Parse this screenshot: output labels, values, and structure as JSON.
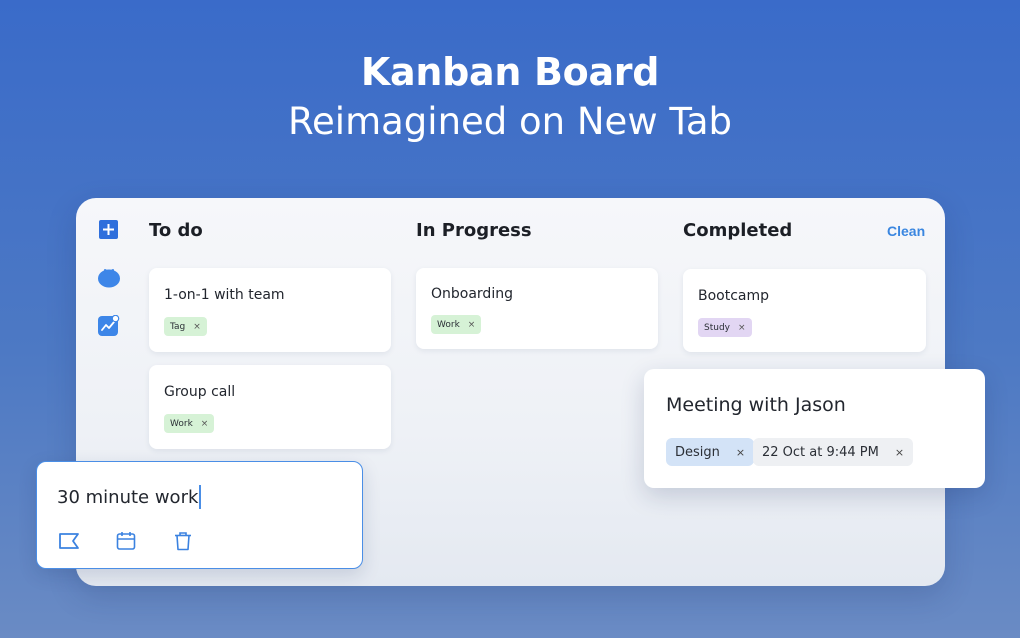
{
  "hero": {
    "title": "Kanban Board",
    "subtitle": "Reimagined on New Tab"
  },
  "sidebar": {
    "icons": [
      "add-icon",
      "tomato-timer-icon",
      "chart-icon"
    ],
    "accent": "#2f6fdc"
  },
  "columns": [
    {
      "title": "To do",
      "cards": [
        {
          "title": "1-on-1 with team",
          "tag": "Tag",
          "tag_color": "#d6f2d6"
        },
        {
          "title": "Group call",
          "tag": "Work",
          "tag_color": "#d6f2d6"
        }
      ]
    },
    {
      "title": "In Progress",
      "cards": [
        {
          "title": "Onboarding",
          "tag": "Work",
          "tag_color": "#d6f2d6"
        }
      ]
    },
    {
      "title": "Completed",
      "cards": [
        {
          "title": "Bootcamp",
          "tag": "Study",
          "tag_color": "#e2d6f3"
        }
      ]
    }
  ],
  "clean_label": "Clean",
  "floating_card": {
    "title": "Meeting with Jason",
    "tag": "Design",
    "due": "22 Oct at 9:44 PM"
  },
  "new_task": {
    "value": "30 minute work",
    "tools": [
      "flag-icon",
      "calendar-icon",
      "trash-icon"
    ]
  },
  "remove_symbol": "×"
}
